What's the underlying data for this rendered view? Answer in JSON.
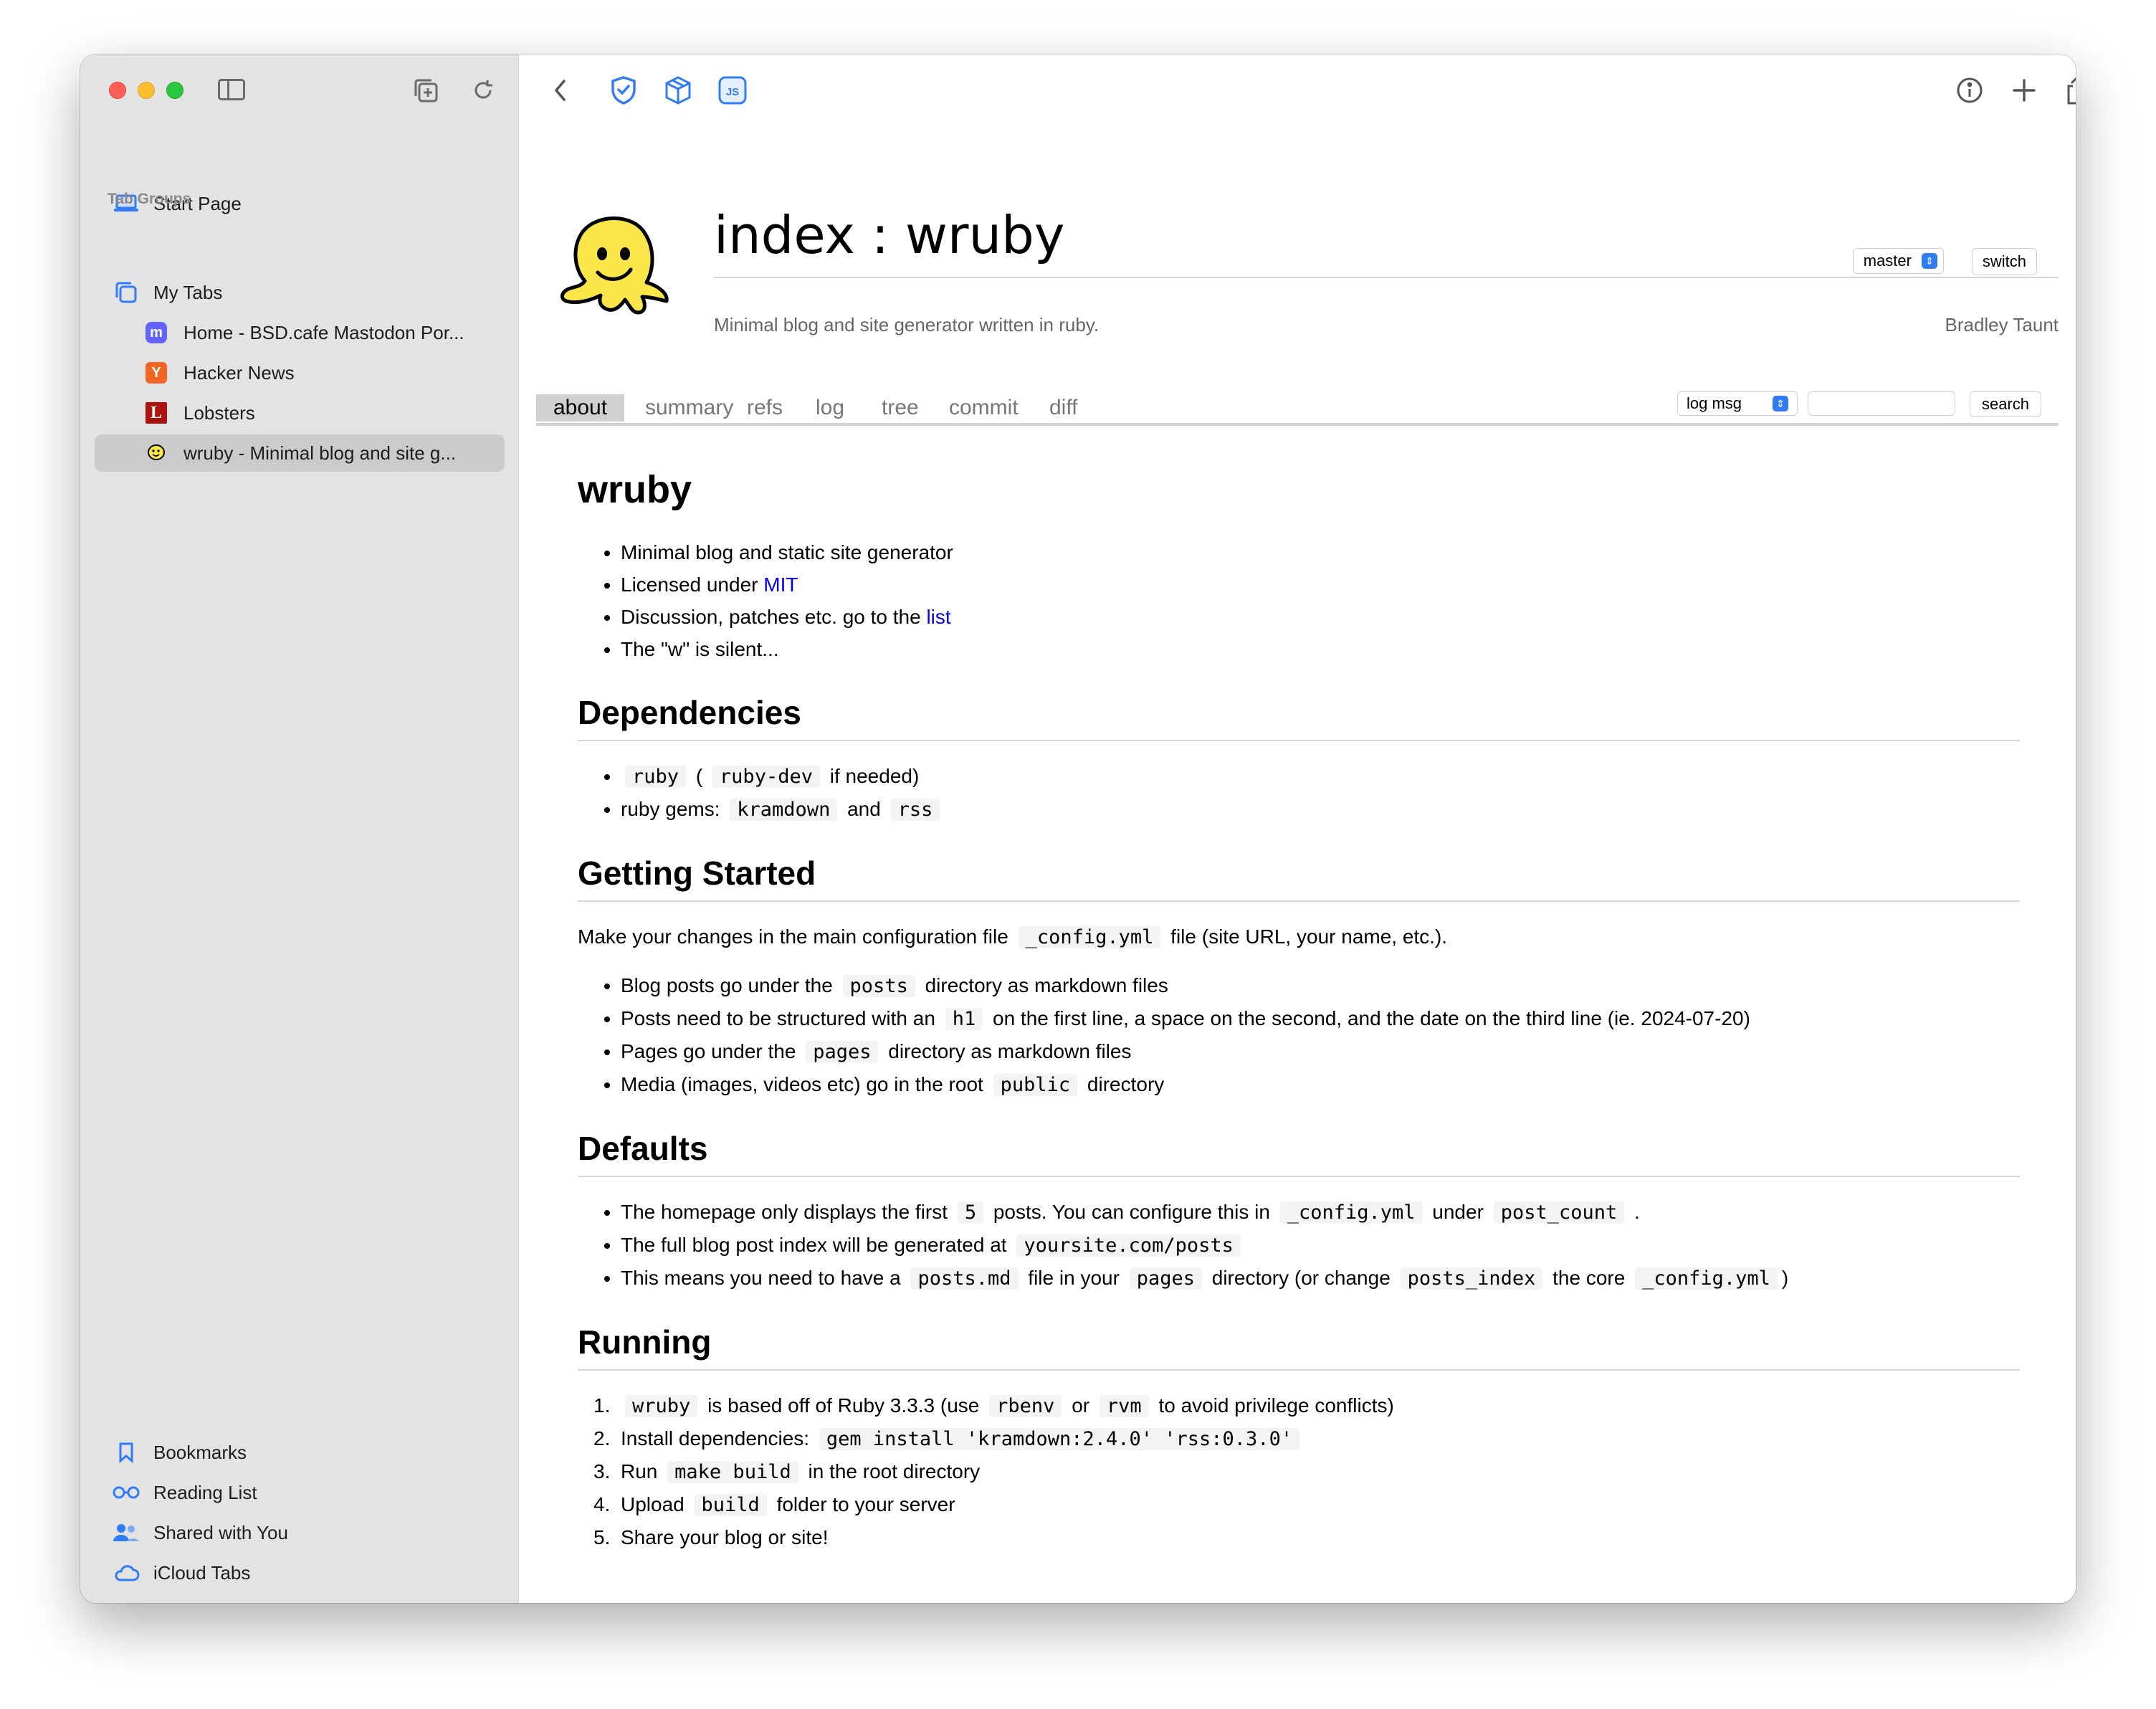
{
  "sidebar": {
    "start_page": "Start Page",
    "tab_groups_heading": "Tab Groups",
    "my_tabs": "My Tabs",
    "tabs": [
      {
        "label": "Home - BSD.cafe Mastodon Por...",
        "favicon": "mastodon-icon"
      },
      {
        "label": "Hacker News",
        "favicon": "hacker-news-icon",
        "favicon_text": "Y"
      },
      {
        "label": "Lobsters",
        "favicon": "lobsters-icon",
        "favicon_text": "L"
      },
      {
        "label": "wruby - Minimal blog and site g...",
        "favicon": "cgit-logo-icon",
        "selected": true
      }
    ],
    "bottom": {
      "bookmarks": "Bookmarks",
      "reading_list": "Reading List",
      "shared_with_you": "Shared with You",
      "icloud_tabs": "iCloud Tabs"
    }
  },
  "toolbar": {
    "js_badge": "JS"
  },
  "repo": {
    "title": "index : wruby",
    "branch": "master",
    "switch_label": "switch",
    "description": "Minimal blog and site generator written in ruby.",
    "owner": "Bradley Taunt"
  },
  "tabs": {
    "about": "about",
    "summary": "summary",
    "refs": "refs",
    "log": "log",
    "tree": "tree",
    "commit": "commit",
    "diff": "diff",
    "search_type": "log msg",
    "search_value": "",
    "search_button": "search"
  },
  "readme": {
    "title": "wruby",
    "intro": {
      "item1": "Minimal blog and static site generator",
      "item2_pre": "Licensed under ",
      "item2_link": "MIT",
      "item3_pre": "Discussion, patches etc. go to the ",
      "item3_link": "list",
      "item4": "The \"w\" is silent..."
    },
    "deps": {
      "heading": "Dependencies",
      "ruby": "ruby",
      "open_paren": "(",
      "ruby_dev": "ruby-dev",
      "if_needed": "if needed)",
      "gems_pre": "ruby gems:",
      "kramdown": "kramdown",
      "and": "and",
      "rss": "rss"
    },
    "getting_started": {
      "heading": "Getting Started",
      "p_pre": "Make your changes in the main configuration file",
      "config": "_config.yml",
      "p_post": "file (site URL, your name, etc.).",
      "l1_pre": "Blog posts go under the",
      "posts": "posts",
      "l1_post": "directory as markdown files",
      "l2_pre": "Posts need to be structured with an",
      "h1": "h1",
      "l2_post": "on the first line, a space on the second, and the date on the third line (ie. 2024-07-20)",
      "l3_pre": "Pages go under the",
      "pages": "pages",
      "l3_post": "directory as markdown files",
      "l4_pre": "Media (images, videos etc) go in the root",
      "public": "public",
      "l4_post": "directory"
    },
    "defaults": {
      "heading": "Defaults",
      "l1_pre": "The homepage only displays the first",
      "five": "5",
      "l1_mid": "posts. You can configure this in",
      "config": "_config.yml",
      "l1_under": "under",
      "post_count": "post_count",
      "l1_end": ".",
      "l2_pre": "The full blog post index will be generated at",
      "url": "yoursite.com/posts",
      "l3_pre": "This means you need to have a",
      "posts_md": "posts.md",
      "l3_mid": "file in your",
      "pages": "pages",
      "l3_mid2": "directory (or change",
      "posts_index": "posts_index",
      "l3_mid3": "the core",
      "config2": "_config.yml",
      "l3_end": ")"
    },
    "running": {
      "heading": "Running",
      "n1": "1.",
      "n2": "2.",
      "n3": "3.",
      "n4": "4.",
      "n5": "5.",
      "wruby": "wruby",
      "s1_mid": "is based off of Ruby 3.3.3 (use",
      "rbenv": "rbenv",
      "or": "or",
      "rvm": "rvm",
      "s1_end": "to avoid privilege conflicts)",
      "s2_pre": "Install dependencies:",
      "gem_cmd": "gem install 'kramdown:2.4.0' 'rss:0.3.0'",
      "s3_pre": "Run",
      "make_build": "make build",
      "s3_post": "in the root directory",
      "s4_pre": "Upload",
      "build": "build",
      "s4_post": "folder to your server",
      "s5": "Share your blog or site!"
    }
  }
}
